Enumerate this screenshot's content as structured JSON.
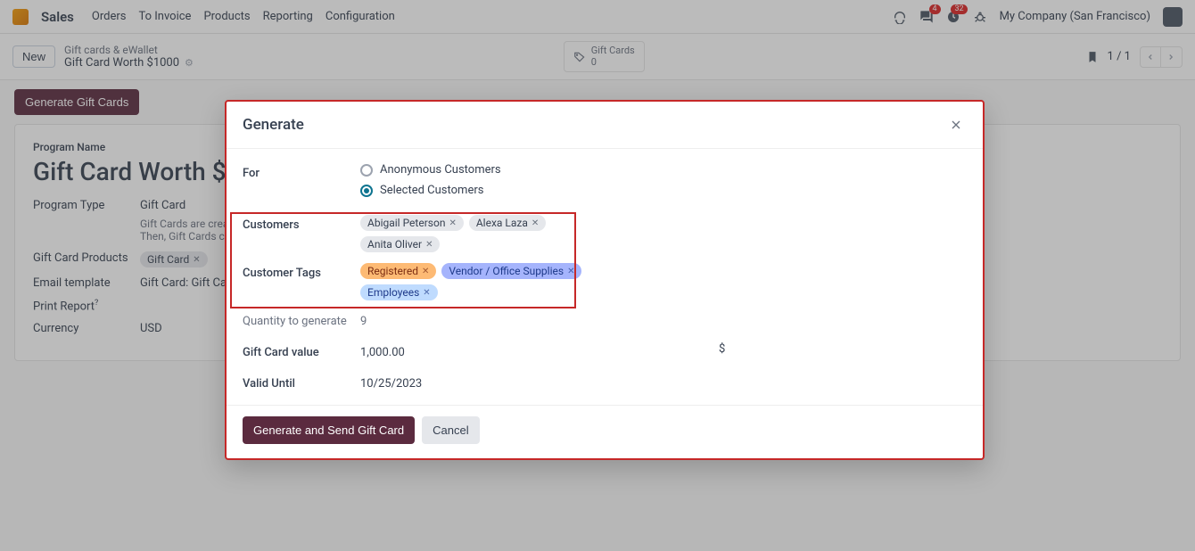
{
  "nav": {
    "app": "Sales",
    "links": [
      "Orders",
      "To Invoice",
      "Products",
      "Reporting",
      "Configuration"
    ],
    "messages_badge": "4",
    "activities_badge": "32",
    "company": "My Company (San Francisco)"
  },
  "controlbar": {
    "new": "New",
    "parent": "Gift cards & eWallet",
    "current": "Gift Card Worth $1000",
    "stat_label": "Gift Cards",
    "stat_value": "0",
    "pager": "1 / 1"
  },
  "form": {
    "generate_btn": "Generate Gift Cards",
    "program_name_label": "Program Name",
    "program_name": "Gift Card Worth $",
    "program_type_label": "Program Type",
    "program_type": "Gift Card",
    "program_desc": "Gift Cards are crea... card product.\nThen, Gift Cards ca...",
    "gift_card_products_label": "Gift Card Products",
    "gift_card_products_chip": "Gift Card",
    "email_template_label": "Email template",
    "email_template": "Gift Card: Gift Card",
    "print_report_label": "Print Report",
    "currency_label": "Currency",
    "currency": "USD"
  },
  "modal": {
    "title": "Generate",
    "for_label": "For",
    "for_anon": "Anonymous Customers",
    "for_selected": "Selected Customers",
    "customers_label": "Customers",
    "customers": [
      "Abigail Peterson",
      "Alexa Laza",
      "Anita Oliver"
    ],
    "customer_tags_label": "Customer Tags",
    "customer_tags": [
      {
        "text": "Registered",
        "cls": "tag-orange"
      },
      {
        "text": "Vendor / Office Supplies",
        "cls": "tag-blue"
      },
      {
        "text": "Employees",
        "cls": "tag-blue2"
      }
    ],
    "qty_label": "Quantity to generate",
    "qty": "9",
    "value_label": "Gift Card value",
    "value": "1,000.00",
    "currency_symbol": "$",
    "valid_label": "Valid Until",
    "valid": "10/25/2023",
    "btn_primary": "Generate and Send Gift Card",
    "btn_cancel": "Cancel"
  }
}
